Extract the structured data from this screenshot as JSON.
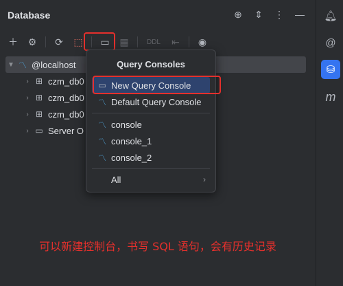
{
  "panel": {
    "title": "Database"
  },
  "toolbar": {
    "ddl_label": "DDL"
  },
  "tree": {
    "root": "@localhost",
    "items": [
      {
        "label": "czm_db0"
      },
      {
        "label": "czm_db0"
      },
      {
        "label": "czm_db0"
      },
      {
        "label": "Server O"
      }
    ]
  },
  "popup": {
    "title": "Query Consoles",
    "items": [
      {
        "label": "New Query Console"
      },
      {
        "label": "Default Query Console"
      },
      {
        "label": "console"
      },
      {
        "label": "console_1"
      },
      {
        "label": "console_2"
      },
      {
        "label": "All"
      }
    ]
  },
  "caption": "可以新建控制台，书写 SQL 语句，会有历史记录",
  "right_bar": {
    "m_label": "m"
  },
  "colors": {
    "accent": "#3574f0",
    "highlight": "#e5302c",
    "selection": "#2e436e"
  }
}
